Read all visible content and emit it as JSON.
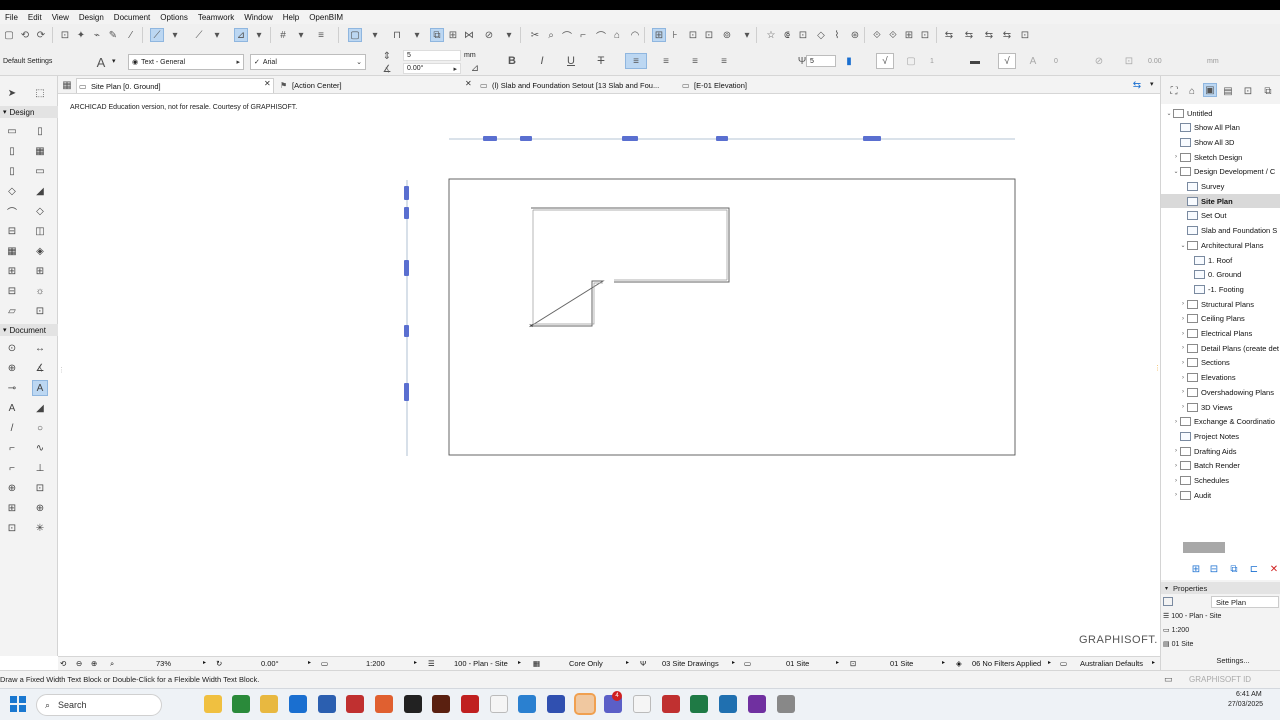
{
  "menu": [
    "File",
    "Edit",
    "View",
    "Design",
    "Document",
    "Options",
    "Teamwork",
    "Window",
    "Help",
    "OpenBIM"
  ],
  "infobox": {
    "default_settings": "Default Settings",
    "favorite": "Text - General",
    "font": "Arial",
    "size_value": "5",
    "size_unit": "mm",
    "angle_value": "0.00°",
    "pen_value": "5",
    "count_a": "1",
    "count_b": "0",
    "offset_value": "0.00",
    "offset_unit": "mm",
    "bold": "B",
    "italic": "I",
    "underline": "U",
    "strike": "T"
  },
  "toolbox": {
    "design_header": "Design",
    "document_header": "Document"
  },
  "tabs": [
    {
      "label": "Site Plan [0. Ground]"
    },
    {
      "label": "[Action Center]"
    },
    {
      "label": "(l) Slab and Foundation Setout [13 Slab and Fou..."
    },
    {
      "label": "[E-01 Elevation]"
    }
  ],
  "canvas": {
    "watermark": "ARCHICAD Education version, not for resale. Courtesy of GRAPHISOFT.",
    "brand": "GRAPHISOFT."
  },
  "navigator": {
    "items": [
      {
        "label": "Untitled",
        "indent": 0,
        "exp": "⌄",
        "sel": false
      },
      {
        "label": "Show All Plan",
        "indent": 1,
        "exp": "",
        "sel": false
      },
      {
        "label": "Show All 3D",
        "indent": 1,
        "exp": "",
        "sel": false
      },
      {
        "label": "Sketch Design",
        "indent": 1,
        "exp": "›",
        "sel": false
      },
      {
        "label": "Design Development / C",
        "indent": 1,
        "exp": "⌄",
        "sel": false
      },
      {
        "label": "Survey",
        "indent": 2,
        "exp": "",
        "sel": false
      },
      {
        "label": "Site Plan",
        "indent": 2,
        "exp": "",
        "sel": true
      },
      {
        "label": "Set Out",
        "indent": 2,
        "exp": "",
        "sel": false
      },
      {
        "label": "Slab and Foundation S",
        "indent": 2,
        "exp": "",
        "sel": false
      },
      {
        "label": "Architectural Plans",
        "indent": 2,
        "exp": "⌄",
        "sel": false
      },
      {
        "label": "1. Roof",
        "indent": 3,
        "exp": "",
        "sel": false
      },
      {
        "label": "0. Ground",
        "indent": 3,
        "exp": "",
        "sel": false
      },
      {
        "label": "-1. Footing",
        "indent": 3,
        "exp": "",
        "sel": false
      },
      {
        "label": "Structural Plans",
        "indent": 2,
        "exp": "›",
        "sel": false
      },
      {
        "label": "Ceiling Plans",
        "indent": 2,
        "exp": "›",
        "sel": false
      },
      {
        "label": "Electrical Plans",
        "indent": 2,
        "exp": "›",
        "sel": false
      },
      {
        "label": "Detail Plans (create det",
        "indent": 2,
        "exp": "›",
        "sel": false
      },
      {
        "label": "Sections",
        "indent": 2,
        "exp": "›",
        "sel": false
      },
      {
        "label": "Elevations",
        "indent": 2,
        "exp": "›",
        "sel": false
      },
      {
        "label": "Overshadowing Plans",
        "indent": 2,
        "exp": "›",
        "sel": false
      },
      {
        "label": "3D Views",
        "indent": 2,
        "exp": "›",
        "sel": false
      },
      {
        "label": "Exchange & Coordinatio",
        "indent": 1,
        "exp": "›",
        "sel": false
      },
      {
        "label": "Project Notes",
        "indent": 1,
        "exp": "",
        "sel": false
      },
      {
        "label": "Drafting Aids",
        "indent": 1,
        "exp": "›",
        "sel": false
      },
      {
        "label": "Batch Render",
        "indent": 1,
        "exp": "›",
        "sel": false
      },
      {
        "label": "Schedules",
        "indent": 1,
        "exp": "›",
        "sel": false
      },
      {
        "label": "Audit",
        "indent": 1,
        "exp": "›",
        "sel": false
      }
    ]
  },
  "properties": {
    "header": "Properties",
    "name": "Site Plan",
    "layer_combo": "100 - Plan - Site",
    "scale": "1:200",
    "layout": "01 Site",
    "settings_button": "Settings...",
    "graphisoft_id": "GRAPHISOFT ID"
  },
  "statusbar": {
    "zoom": "73%",
    "rotation": "0.00°",
    "scale": "1:200",
    "layer_combo": "100 - Plan - Site",
    "structure": "Core Only",
    "pen_set": "03 Site Drawings",
    "model_view": "01 Site",
    "dimension": "01 Site",
    "renovation": "06 No Filters Applied",
    "standard": "Australian Defaults"
  },
  "hint": "Draw a Fixed Width Text Block or Double-Click for a Flexible Width Text Block.",
  "taskbar": {
    "search_placeholder": "Search",
    "time": "6:41 AM",
    "date": "27/03/2025",
    "teams_badge": "4"
  },
  "colors": {
    "selection": "#bcd7f2",
    "dimension_marker": "#5a6fd0",
    "close_red": "#d02020"
  }
}
